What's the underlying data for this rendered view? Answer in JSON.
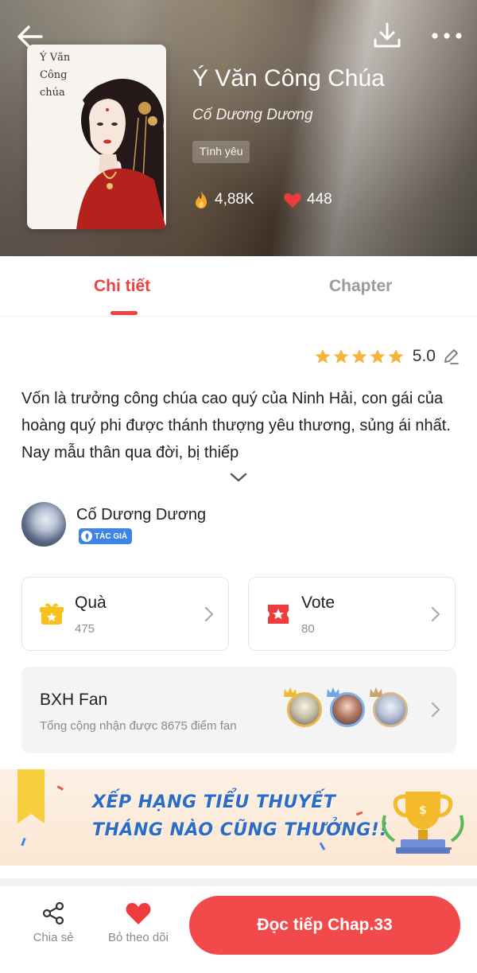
{
  "header": {
    "cover_text": "Ý Văn\nCông\nchúa",
    "title": "Ý Văn Công Chúa",
    "author": "Cố Dương Dương",
    "genre": "Tình yêu",
    "views": "4,88K",
    "likes": "448",
    "icons": {
      "back": "back-arrow-icon",
      "download": "download-icon",
      "more": "more-icon"
    }
  },
  "tabs": [
    {
      "label": "Chi tiết",
      "active": true
    },
    {
      "label": "Chapter",
      "active": false
    }
  ],
  "rating": {
    "value": "5.0",
    "stars": 5
  },
  "description": "Vốn là trưởng công chúa cao quý của Ninh Hải, con gái của hoàng quý phi được thánh thượng yêu thương, sủng ái nhất. Nay mẫu thân qua đời, bị thiếp",
  "author_row": {
    "name": "Cố Dương Dương",
    "badge": "TÁC GIẢ"
  },
  "cards": {
    "gift": {
      "label": "Quà",
      "count": "475"
    },
    "vote": {
      "label": "Vote",
      "count": "80"
    }
  },
  "fan_ranking": {
    "title": "BXH Fan",
    "subtitle": "Tổng cộng nhận được 8675 điểm fan"
  },
  "banner": {
    "line1": "XẾP HẠNG TIỂU THUYẾT",
    "line2": "THÁNG NÀO CŨNG THƯỞNG!!"
  },
  "bottom_bar": {
    "share_label": "Chia sẻ",
    "follow_label": "Bỏ theo dõi",
    "read_label": "Đọc tiếp Chap.33"
  },
  "colors": {
    "accent": "#ea4343",
    "button": "#f24a4a",
    "star": "#f6b43a",
    "badge": "#3d84e6"
  }
}
